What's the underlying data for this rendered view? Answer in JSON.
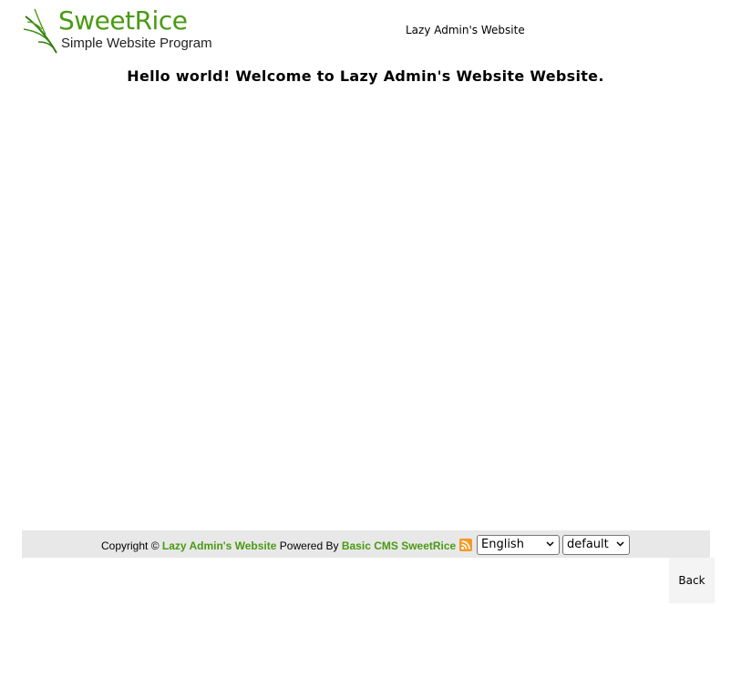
{
  "header": {
    "logo_title": "SweetRice",
    "logo_subtitle": "Simple Website Program",
    "site_title": "Lazy Admin's Website"
  },
  "main": {
    "welcome": "Hello world! Welcome to Lazy Admin's Website Website."
  },
  "footer": {
    "copyright_prefix": "Copyright ©",
    "site_link": "Lazy Admin's Website",
    "powered_by": "Powered By",
    "cms_link": "Basic CMS SweetRice",
    "rss_icon": "rss-icon",
    "language_select": "English",
    "theme_select": "default"
  },
  "back_button": "Back",
  "colors": {
    "brand_green": "#4a9a12",
    "rss_orange": "#f39a2b",
    "footer_bg": "#e8e8e8"
  }
}
